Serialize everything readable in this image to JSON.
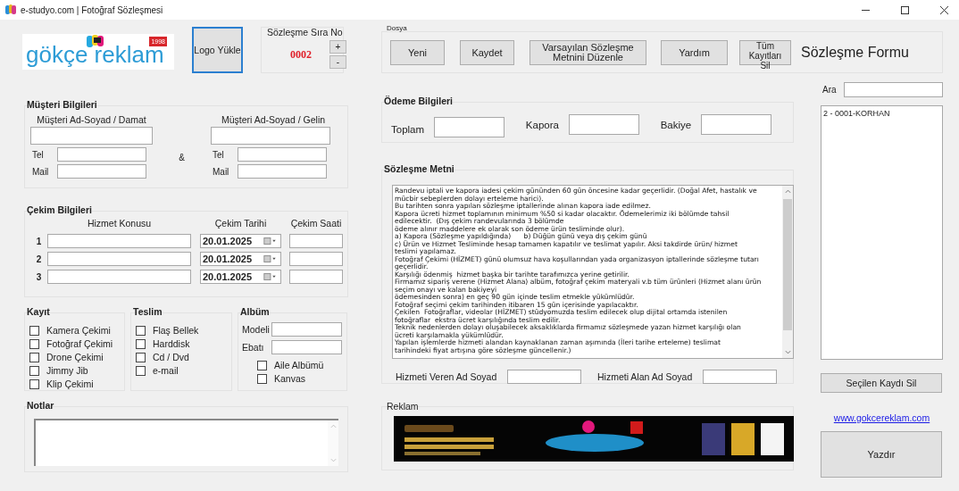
{
  "window": {
    "title": "e-studyo.com | Fotoğraf Sözleşmesi"
  },
  "logo": {
    "text": "gökçe reklam",
    "year": "1998"
  },
  "logo_button": "Logo Yükle",
  "contract_no": {
    "label": "Sözleşme Sıra No",
    "value": "0002",
    "buttons": [
      "+",
      "-"
    ]
  },
  "file_group": {
    "title": "Dosya",
    "buttons": [
      "Yeni",
      "Kaydet",
      "Varsayılan Sözleşme Metnini Düzenle",
      "Yardım",
      "Tüm Kayıtları Sil"
    ],
    "heading": "Sözleşme Formu"
  },
  "customer": {
    "title": "Müşteri Bilgileri",
    "separator": "&",
    "columns": [
      {
        "label": "Müşteri Ad-Soyad / Damat",
        "tel_label": "Tel",
        "mail_label": "Mail"
      },
      {
        "label": "Müşteri Ad-Soyad / Gelin",
        "tel_label": "Tel",
        "mail_label": "Mail"
      }
    ]
  },
  "shoot": {
    "title": "Çekim Bilgileri",
    "headers": [
      "Hizmet Konusu",
      "Çekim Tarihi",
      "Çekim Saati"
    ],
    "rows": [
      {
        "number": "1",
        "date": "20.01.2025"
      },
      {
        "number": "2",
        "date": "20.01.2025"
      },
      {
        "number": "3",
        "date": "20.01.2025"
      }
    ]
  },
  "recording": {
    "title": "Kayıt",
    "options": [
      {
        "label": "Kamera Çekimi",
        "checked": false
      },
      {
        "label": "Fotoğraf Çekimi",
        "checked": false
      },
      {
        "label": "Drone Çekimi",
        "checked": false
      },
      {
        "label": "Jimmy Jib",
        "checked": false
      },
      {
        "label": "Klip Çekimi",
        "checked": false
      }
    ]
  },
  "delivery": {
    "title": "Teslim",
    "options": [
      {
        "label": "Flaş Bellek",
        "checked": false
      },
      {
        "label": "Harddisk",
        "checked": false
      },
      {
        "label": "Cd / Dvd",
        "checked": false
      },
      {
        "label": "e-mail",
        "checked": false
      }
    ]
  },
  "album": {
    "title": "Albüm",
    "fields": [
      "Modeli",
      "Ebatı"
    ],
    "options": [
      {
        "label": "Aile Albümü",
        "checked": false
      },
      {
        "label": "Kanvas",
        "checked": false
      }
    ]
  },
  "notes": {
    "title": "Notlar"
  },
  "payment": {
    "title": "Ödeme Bilgileri",
    "fields": [
      "Toplam",
      "Kapora",
      "Bakiye"
    ]
  },
  "contract": {
    "title": "Sözleşme Metni",
    "text": "Randevu iptali ve kapora iadesi çekim gününden 60 gün öncesine kadar geçerlidir. (Doğal Afet, hastalık ve\nmücbir sebeplerden dolayı erteleme harici).\nBu tarihten sonra yapılan sözleşme iptallerinde alınan kapora iade edilmez.\nKapora ücreti hizmet toplamının minimum %50 si kadar olacaktır. Ödemelerimiz iki bölümde tahsil\nedilecektir.  (Dış çekim randevularında 3 bölümde\nödeme alınır maddelere ek olarak son ödeme ürün tesliminde olur).\na) Kapora (Sözleşme yapıldığında)      b) Düğün günü veya dış çekim günü\nc) Ürün ve Hizmet Tesliminde hesap tamamen kapatılır ve teslimat yapılır. Aksi takdirde ürün/ hizmet\nteslimi yapılamaz.\nFotoğraf Çekimi (HİZMET) günü olumsuz hava koşullarından yada organizasyon iptallerinde sözleşme tutarı\ngeçerlidir.\nKarşılığı ödenmiş  hizmet başka bir tarihte tarafımızca yerine getirilir.\nFirmamız sipariş verene (Hizmet Alana) albüm, fotoğraf çekim materyali v.b tüm ürünleri (Hizmet alanı ürün\nseçim onayı ve kalan bakiyeyi\nödemesinden sonra) en geç 90 gün içinde teslim etmekle yükümlüdür.\nFotoğraf seçimi çekim tarihinden itibaren 15 gün içerisinde yapılacaktır.\nÇekilen  Fotoğraflar, videolar (HİZMET) stüdyomuzda teslim edilecek olup dijital ortamda istenilen\nfotoğraflar  ekstra ücret karşılığında teslim edilir.\nTeknik nedenlerden dolayı oluşabilecek aksaklıklarda firmamız sözleşmede yazan hizmet karşılığı olan\nücreti karşılamakla yükümlüdür.\nYapılan işlemlerde hizmeti alandan kaynaklanan zaman aşımında (İleri tarihe erteleme) teslimat\ntarihindeki fiyat artışına göre sözleşme güncellenir.)",
    "signatures": [
      "Hizmeti Veren Ad Soyad",
      "Hizmeti Alan Ad Soyad"
    ]
  },
  "ad": {
    "title": "Reklam"
  },
  "search": {
    "label": "Ara"
  },
  "records": [
    "2 - 0001-KORHAN"
  ],
  "delete_button": "Seçilen Kaydı Sil",
  "link": "www.gokcereklam.com",
  "print_button": "Yazdır"
}
